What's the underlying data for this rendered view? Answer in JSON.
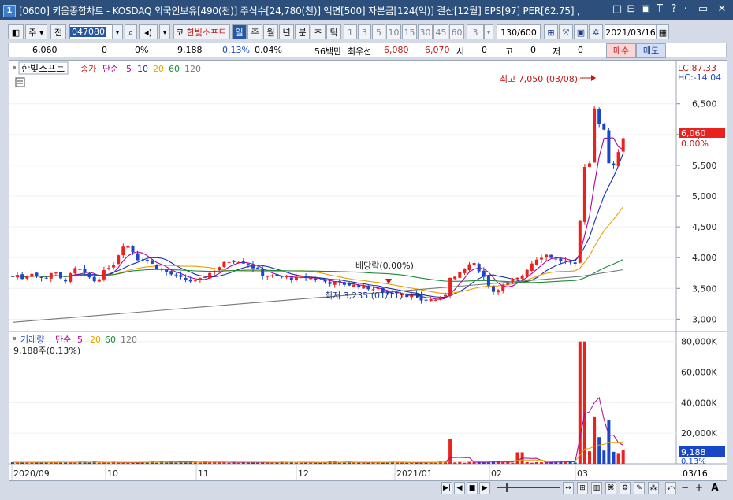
{
  "window": {
    "number": "1",
    "title": "[0600] 키움종합차트 - KOSDAQ 외국인보유[490(천)] 주식수[24,780(천)] 액면[500] 자본금[124(억)] 결산[12월] EPS[97] PER[62.75] ,",
    "controls": [
      "□",
      "⊟",
      "▣",
      "T",
      "?",
      "·",
      "▭",
      "✕"
    ]
  },
  "toolbar": {
    "period_unit": "주",
    "prev_label": "전",
    "code": "047080",
    "stock_name": "한빛소프트",
    "code_prefix": "코",
    "periods": [
      "일",
      "주",
      "월",
      "년",
      "분",
      "초",
      "틱"
    ],
    "selected_period": "일",
    "minute_options": [
      "1",
      "3",
      "5",
      "10",
      "15",
      "30",
      "45",
      "60"
    ],
    "interval_value": "3",
    "count": "130/600",
    "date": "2021/03/16"
  },
  "quote": {
    "price": "6,060",
    "change": "0",
    "change_rate": "0%",
    "volume": "9,188",
    "volume_rate": "0.13%",
    "turnover": "0.04%",
    "amount": "56백만",
    "best_label": "최우선",
    "ask": "6,080",
    "bid": "6,070",
    "open_label": "시",
    "open_val": "0",
    "high_label": "고",
    "high_val": "0",
    "low_label": "저",
    "low_val": "0",
    "buy_label": "매수",
    "sell_label": "매도"
  },
  "price_panel": {
    "stock_label": "한빛소프트",
    "close_label": "종가",
    "ma_label": "단순",
    "ma_periods": [
      "5",
      "10",
      "20",
      "60",
      "120"
    ],
    "ma_colors": [
      "#b0009a",
      "#1b2fa8",
      "#e6a100",
      "#1c8a3a",
      "#777777"
    ],
    "lc": "LC:87.33",
    "hc": "HC:-14.04",
    "current_price": "6,060",
    "current_rate": "0.00%",
    "y_ticks": [
      "6,500",
      "6,000",
      "5,500",
      "5,000",
      "4,500",
      "4,000",
      "3,500",
      "3,000"
    ],
    "high_note": "최고 7,050 (03/08)",
    "low_note": "최저 3,235 (01/11)",
    "dividend_note": "배당락(0.00%)"
  },
  "volume_panel": {
    "label": "거래량",
    "ma_label": "단순",
    "ma_periods": [
      "5",
      "20",
      "60",
      "120"
    ],
    "ma_colors": [
      "#b0009a",
      "#e6a100",
      "#1c8a3a",
      "#777777"
    ],
    "current": "9,188주(0.13%)",
    "current_volume": "9,188",
    "current_rate": "0.13%",
    "y_ticks": [
      "80,000K",
      "60,000K",
      "40,000K",
      "20,000K"
    ]
  },
  "x_axis": {
    "labels": [
      "2020/09",
      "10",
      "11",
      "12",
      "2021/01",
      "02",
      "03"
    ],
    "last_date": "03/16"
  },
  "colors": {
    "up": "#e8231e",
    "down": "#1a47c7",
    "titlebar": "#2d4f7c"
  },
  "chart_data": {
    "type": "candlestick",
    "title": "한빛소프트",
    "x_labels": [
      "2020/09",
      "10",
      "11",
      "12",
      "2021/01",
      "02",
      "03",
      "03/16"
    ],
    "ylim": [
      2800,
      7200
    ],
    "y_ticks": [
      3000,
      3500,
      4000,
      4500,
      5000,
      5500,
      6000,
      6500
    ],
    "last": {
      "date": "2021/03/16",
      "close": 6060,
      "volume": 9188,
      "volume_rate_pct": 0.13
    },
    "highest": {
      "date": "03/08",
      "price": 7050
    },
    "lowest": {
      "date": "01/11",
      "price": 3235
    },
    "volume_ylim": [
      0,
      85000000
    ],
    "volume_y_ticks": [
      20000000,
      40000000,
      60000000,
      80000000
    ],
    "moving_averages": [
      "5",
      "10",
      "20",
      "60",
      "120"
    ]
  }
}
